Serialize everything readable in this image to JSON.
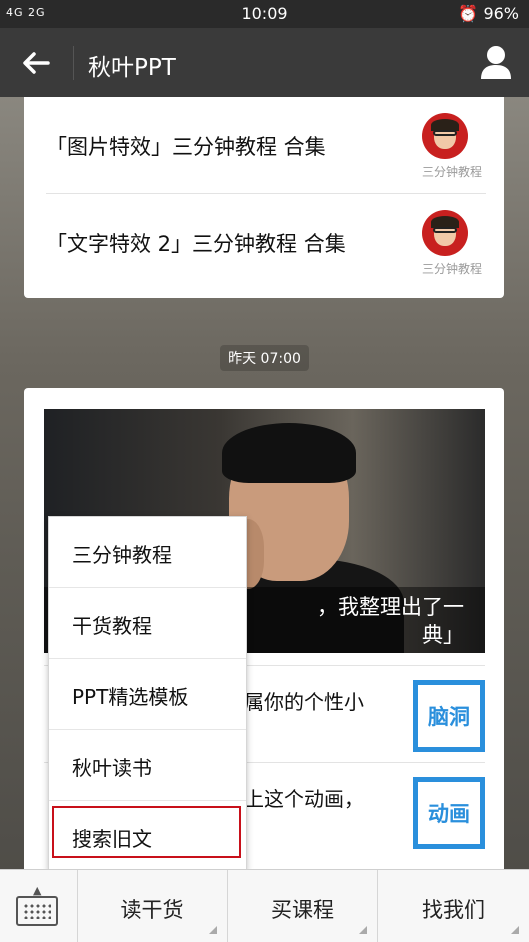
{
  "status_bar": {
    "network": "4G 2G",
    "time": "10:09",
    "battery": "96%"
  },
  "header": {
    "title": "秋叶PPT"
  },
  "articles": [
    {
      "title": "「图片特效」三分钟教程 合集",
      "avatar_caption": "三分钟教程"
    },
    {
      "title": "「文字特效 2」三分钟教程 合集",
      "avatar_caption": "三分钟教程"
    }
  ],
  "timestamp": "昨天 07:00",
  "feature": {
    "caption": "，我整理出了一\n典」"
  },
  "messages": [
    {
      "text": "属你的个性小",
      "thumb": "脑洞"
    },
    {
      "text": "上这个动画，",
      "thumb": "动画"
    }
  ],
  "menu": {
    "items": [
      "三分钟教程",
      "干货教程",
      "PPT精选模板",
      "秋叶读书",
      "搜索旧文"
    ],
    "highlighted": "搜索旧文"
  },
  "bottom_bar": {
    "tabs": [
      "读干货",
      "买课程",
      "找我们"
    ]
  },
  "colors": {
    "highlight_border": "#c8101a",
    "thumb_blue": "#2a8fdc",
    "titlebar": "#3a3a3a"
  }
}
